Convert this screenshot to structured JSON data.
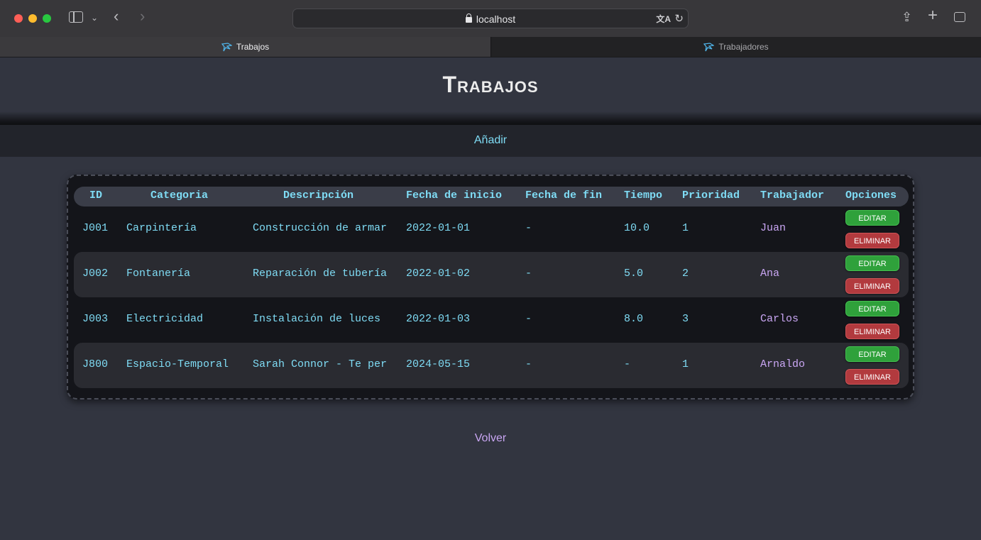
{
  "browser": {
    "address": "localhost",
    "tabs": [
      {
        "label": "Trabajos"
      },
      {
        "label": "Trabajadores"
      }
    ]
  },
  "page": {
    "title": "Trabajos",
    "nav_add": "Añadir",
    "back_link": "Volver"
  },
  "table": {
    "headers": [
      "ID",
      "Categoria",
      "Descripción",
      "Fecha de inicio",
      "Fecha de fin",
      "Tiempo",
      "Prioridad",
      "Trabajador",
      "Opciones"
    ],
    "edit_label": "EDITAR",
    "delete_label": "ELIMINAR",
    "rows": [
      {
        "id": "J001",
        "categoria": "Carpintería",
        "descripcion": "Construcción de armar",
        "inicio": "2022-01-01",
        "fin": "-",
        "tiempo": "10.0",
        "prioridad": "1",
        "trabajador": "Juan"
      },
      {
        "id": "J002",
        "categoria": "Fontanería",
        "descripcion": "Reparación de tubería",
        "inicio": "2022-01-02",
        "fin": "-",
        "tiempo": "5.0",
        "prioridad": "2",
        "trabajador": "Ana"
      },
      {
        "id": "J003",
        "categoria": "Electricidad",
        "descripcion": "Instalación de luces",
        "inicio": "2022-01-03",
        "fin": "-",
        "tiempo": "8.0",
        "prioridad": "3",
        "trabajador": "Carlos"
      },
      {
        "id": "J800",
        "categoria": "Espacio-Temporal",
        "descripcion": "Sarah Connor - Te per",
        "inicio": "2024-05-15",
        "fin": "-",
        "tiempo": "-",
        "prioridad": "1",
        "trabajador": "Arnaldo"
      }
    ]
  },
  "colors": {
    "accent_cyan": "#7fdcf5",
    "accent_purple": "#c9a6f3",
    "edit_green": "#2fa13b",
    "delete_red": "#b23a3e"
  }
}
